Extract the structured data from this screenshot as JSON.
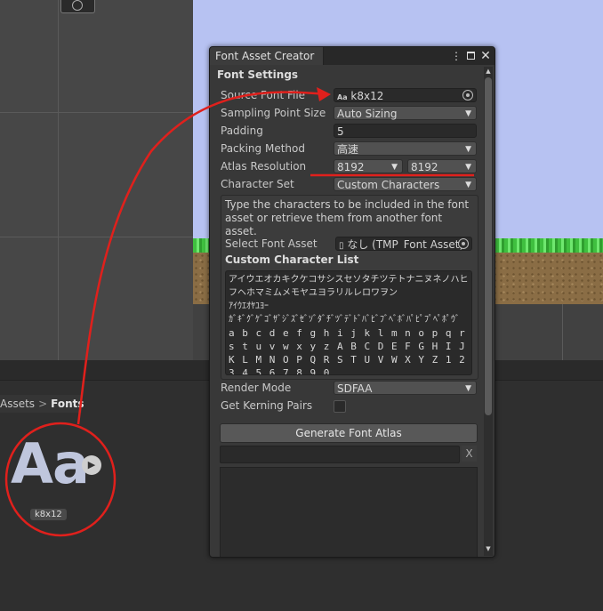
{
  "window": {
    "title": "Font Asset Creator",
    "section_title": "Font Settings",
    "rows": {
      "source_font_label": "Source Font File",
      "source_font_value": "k8x12",
      "source_font_icon_text": "Aa",
      "sampling_label": "Sampling Point Size",
      "sampling_value": "Auto Sizing",
      "padding_label": "Padding",
      "padding_value": "5",
      "packing_label": "Packing Method",
      "packing_value": "高速",
      "atlas_label": "Atlas Resolution",
      "atlas_width": "8192",
      "atlas_height": "8192",
      "charset_label": "Character Set",
      "charset_value": "Custom Characters",
      "help_text": "Type the characters to be included in the font asset or retrieve them from another font asset.",
      "select_font_asset_label": "Select Font Asset",
      "select_font_asset_value": "なし (TMP_Font Asset)",
      "custom_list_label": "Custom Character List",
      "custom_chars_kana_1": "アイウエオカキクケコサシスセソタチツテトナニヌネノハヒフヘホマミムメモヤユヨラリルレロワヲン",
      "custom_chars_kana_2": "ｱｲｳｴｵﾔﾕﾖｰ",
      "custom_chars_kana_3": "ｶﾞｷﾞｸﾞｹﾞｺﾞｻﾞｼﾞｽﾞｾﾞｿﾞﾀﾞﾁﾞﾂﾞﾃﾞﾄﾞﾊﾞﾋﾞﾌﾞﾍﾞﾎﾞﾊﾟﾋﾟﾌﾟﾍﾟﾎﾟｳﾞ",
      "custom_chars_latin": "a b c d e f g h i j k l m n o p q r s t u v w x y z A B C D E F G H I J K L M N O P Q R S T U V W X Y Z 1 2 3 4 5 6 7 8 9 0",
      "render_mode_label": "Render Mode",
      "render_mode_value": "SDFAA",
      "kerning_label": "Get Kerning Pairs",
      "kerning_checked": false
    },
    "generate_button": "Generate Font Atlas",
    "clear_button": "X"
  },
  "project": {
    "breadcrumb": [
      "Assets",
      "Fonts"
    ],
    "asset_preview_text": "Aa",
    "asset_name": "k8x12"
  },
  "colors": {
    "annotation_red": "#e0201c",
    "sky": "#b7c2f2",
    "grass": "#4fd44f"
  },
  "icons": {
    "window_menu": "kebab-menu-icon",
    "maximize": "maximize-icon",
    "close": "close-icon",
    "object_picker": "object-picker-icon",
    "dropdown": "chevron-down-icon",
    "play": "play-icon"
  }
}
